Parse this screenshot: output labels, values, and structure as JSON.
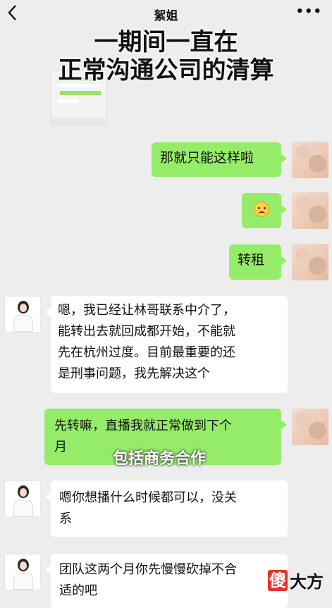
{
  "header": {
    "back_icon": "chevron-left-icon",
    "title": "絮姐",
    "more_icon": "more-dots-icon",
    "more_glyph": "•••"
  },
  "overlay": {
    "line1": "一期间一直在",
    "line2": "正常沟通公司的清算",
    "line3": "包括商务合作"
  },
  "messages": [
    {
      "from": "me",
      "text": "那就只能这样啦"
    },
    {
      "from": "me",
      "emoji": "sad-face-emoji"
    },
    {
      "from": "me",
      "text": "转租"
    },
    {
      "from": "her",
      "lines": [
        "嗯，我已经让林哥联系中介了，",
        "能转出去就回成都开始，不能就",
        "先在杭州过度。目前最重要的还",
        "是刑事问题，我先解决这个"
      ]
    },
    {
      "from": "me",
      "lines": [
        "先转嘛，直播我就正常做到下个",
        "月"
      ]
    },
    {
      "from": "her",
      "lines": [
        "嗯你想播什么时候都可以，没关",
        "系"
      ]
    },
    {
      "from": "her",
      "lines": [
        "团队这两个月你先慢慢砍掉不合",
        "适的吧"
      ]
    }
  ],
  "watermark": {
    "box": "傻",
    "text": "大方"
  },
  "colors": {
    "out_bubble": "#95ec69",
    "in_bubble": "#ffffff",
    "background": "#ededed",
    "watermark_red": "#e8322c"
  }
}
